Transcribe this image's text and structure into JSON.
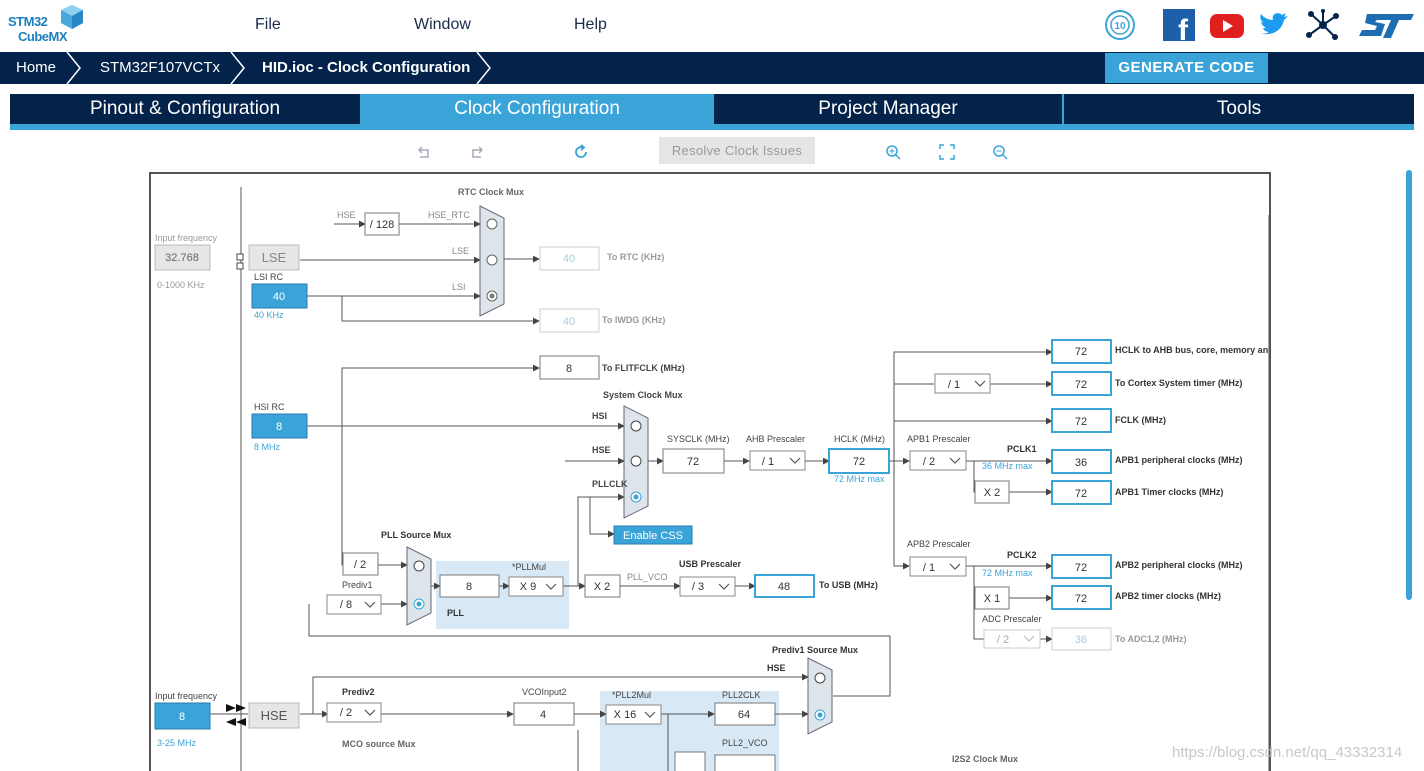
{
  "app": {
    "logo_line1": "STM32",
    "logo_line2": "CubeMX"
  },
  "menu": {
    "file": "File",
    "window": "Window",
    "help": "Help"
  },
  "social_icons": [
    "anniversary-icon",
    "facebook-icon",
    "youtube-icon",
    "twitter-icon",
    "network-icon",
    "st-logo-icon"
  ],
  "breadcrumb": {
    "home": "Home",
    "device": "STM32F107VCTx",
    "file": "HID.ioc - Clock Configuration"
  },
  "generate_button": "GENERATE CODE",
  "tabs": [
    "Pinout & Configuration",
    "Clock Configuration",
    "Project Manager",
    "Tools"
  ],
  "toolbar": {
    "resolve": "Resolve Clock Issues"
  },
  "colors": {
    "navy": "#03234b",
    "accent": "#3aa3d8",
    "pll_bg": "#d8e8f5"
  },
  "clock": {
    "rtc_mux": "RTC Clock Mux",
    "input_freq": "Input frequency",
    "lse_value": "32.768",
    "lse_range": "0-1000 KHz",
    "lse": "LSE",
    "lsi_rc": "LSI RC",
    "lsi_value": "40",
    "lsi_unit": "40 KHz",
    "hse_lbl": "HSE",
    "div128": "/ 128",
    "hse_rtc": "HSE_RTC",
    "lse_lbl": "LSE",
    "lsi_lbl": "LSI",
    "rtc_value": "40",
    "to_rtc": "To RTC (KHz)",
    "iwdg_value": "40",
    "to_iwdg": "To IWDG (KHz)",
    "flit_value": "8",
    "to_flit": "To FLITFCLK (MHz)",
    "sys_mux": "System Clock Mux",
    "hsi_rc": "HSI RC",
    "hsi_value": "8",
    "hsi_unit": "8 MHz",
    "hsi_lbl": "HSI",
    "hse_lbl2": "HSE",
    "pllclk": "PLLCLK",
    "enable_css": "Enable CSS",
    "sysclk_lbl": "SYSCLK (MHz)",
    "sysclk": "72",
    "ahb_lbl": "AHB Prescaler",
    "ahb": "/ 1",
    "hclk_lbl": "HCLK (MHz)",
    "hclk": "72",
    "hclk_max": "72 MHz max",
    "apb1_lbl": "APB1 Prescaler",
    "apb1": "/ 2",
    "pclk1": "PCLK1",
    "pclk1_max": "36 MHz max",
    "apb1_x2": "X 2",
    "apb2_lbl": "APB2 Prescaler",
    "apb2": "/ 1",
    "pclk2": "PCLK2",
    "pclk2_max": "72 MHz max",
    "apb2_x1": "X 1",
    "adc_lbl": "ADC Prescaler",
    "adc": "/ 2",
    "cortex_div": "/ 1",
    "out_ahb": "72",
    "out_ahb_lbl": "HCLK to AHB bus, core, memory and DMA (MHz)",
    "out_cortex": "72",
    "out_cortex_lbl": "To Cortex System timer (MHz)",
    "out_fclk": "72",
    "out_fclk_lbl": "FCLK (MHz)",
    "out_apb1p": "36",
    "out_apb1p_lbl": "APB1 peripheral clocks (MHz)",
    "out_apb1t": "72",
    "out_apb1t_lbl": "APB1 Timer clocks (MHz)",
    "out_apb2p": "72",
    "out_apb2p_lbl": "APB2 peripheral clocks (MHz)",
    "out_apb2t": "72",
    "out_apb2t_lbl": "APB2 timer clocks (MHz)",
    "out_adc": "36",
    "out_adc_lbl": "To ADC1,2 (MHz)",
    "pll_src_mux": "PLL Source Mux",
    "div2": "/ 2",
    "prediv1_lbl": "Prediv1",
    "prediv1": "/ 8",
    "pll_in": "8",
    "pllmul_lbl": "*PLLMul",
    "pllmul": "X 9",
    "pll_lbl": "PLL",
    "x2": "X 2",
    "pll_vco": "PLL_VCO",
    "usb_lbl": "USB Prescaler",
    "usb": "/ 3",
    "usb_out": "48",
    "to_usb": "To USB (MHz)",
    "prediv1_src": "Prediv1 Source Mux",
    "hse_lbl3": "HSE",
    "input_freq2": "Input frequency",
    "hse_value": "8",
    "hse_range": "3-25 MHz",
    "hse_box": "HSE",
    "prediv2_lbl": "Prediv2",
    "prediv2": "/ 2",
    "vco2_lbl": "VCOInput2",
    "vco2": "4",
    "pll2mul_lbl": "*PLL2Mul",
    "pll2mul": "X 16",
    "pll2clk_lbl": "PLL2CLK",
    "pll2clk": "64",
    "pll2vco_lbl": "PLL2_VCO",
    "mco_lbl": "MCO source Mux",
    "i2s_lbl": "I2S2 Clock Mux"
  },
  "watermark": "https://blog.csdn.net/qq_43332314"
}
